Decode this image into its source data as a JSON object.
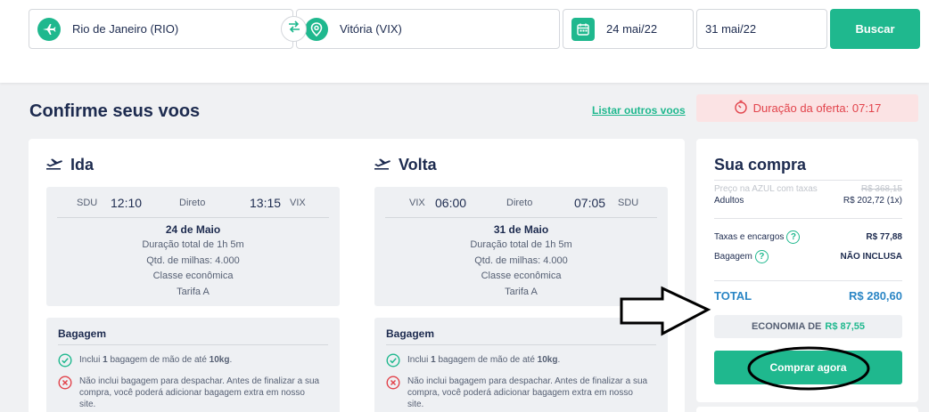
{
  "search": {
    "origin": "Rio de Janeiro (RIO)",
    "destination": "Vitória (VIX)",
    "depart_date": "24 mai/22",
    "return_date": "31 mai/22",
    "search_label": "Buscar"
  },
  "page": {
    "title": "Confirme seus voos",
    "list_other_link": "Listar outros voos",
    "offer_label": "Duração da oferta: 07:17"
  },
  "outbound": {
    "title": "Ida",
    "from_code": "SDU",
    "dep_time": "12:10",
    "stops": "Direto",
    "arr_time": "13:15",
    "to_code": "VIX",
    "date": "24 de Maio",
    "duration": "Duração total de 1h 5m",
    "miles": "Qtd. de milhas: 4.000",
    "cabin": "Classe econômica",
    "fare": "Tarifa A",
    "baggage_title": "Bagagem",
    "bag_included_pre": "Inclui ",
    "bag_included_qty": "1",
    "bag_included_mid": " bagagem de mão de até ",
    "bag_included_weight": "10kg",
    "bag_included_end": ".",
    "bag_excluded": "Não inclui bagagem para despachar. Antes de finalizar a sua compra, você poderá adicionar bagagem extra em nosso site."
  },
  "return": {
    "title": "Volta",
    "from_code": "VIX",
    "dep_time": "06:00",
    "stops": "Direto",
    "arr_time": "07:05",
    "to_code": "SDU",
    "date": "31 de Maio",
    "duration": "Duração total de 1h 5m",
    "miles": "Qtd. de milhas: 4.000",
    "cabin": "Classe econômica",
    "fare": "Tarifa A",
    "baggage_title": "Bagagem",
    "bag_included_pre": "Inclui ",
    "bag_included_qty": "1",
    "bag_included_mid": " bagagem de mão de até ",
    "bag_included_weight": "10kg",
    "bag_included_end": ".",
    "bag_excluded": "Não inclui bagagem para despachar. Antes de finalizar a sua compra, você poderá adicionar bagagem extra em nosso site."
  },
  "summary": {
    "title": "Sua compra",
    "azul_price_label": "Preço na AZUL com taxas",
    "azul_price_value": "R$ 368,15",
    "adults_label": "Adultos",
    "adults_value": "R$ 202,72 (1x)",
    "taxes_label": "Taxas e encargos",
    "taxes_value": "R$ 77,88",
    "baggage_label": "Bagagem",
    "baggage_value": "NÃO INCLUSA",
    "total_label": "TOTAL",
    "total_value": "R$ 280,60",
    "economy_label": "ECONOMIA DE",
    "economy_value": "R$ 87,55",
    "buy_label": "Comprar agora",
    "help_glyph": "?"
  },
  "colors": {
    "accent": "#1fb88e",
    "navy": "#1d2b4f",
    "total_blue": "#2b86c5",
    "offer_red": "#e2434b"
  }
}
